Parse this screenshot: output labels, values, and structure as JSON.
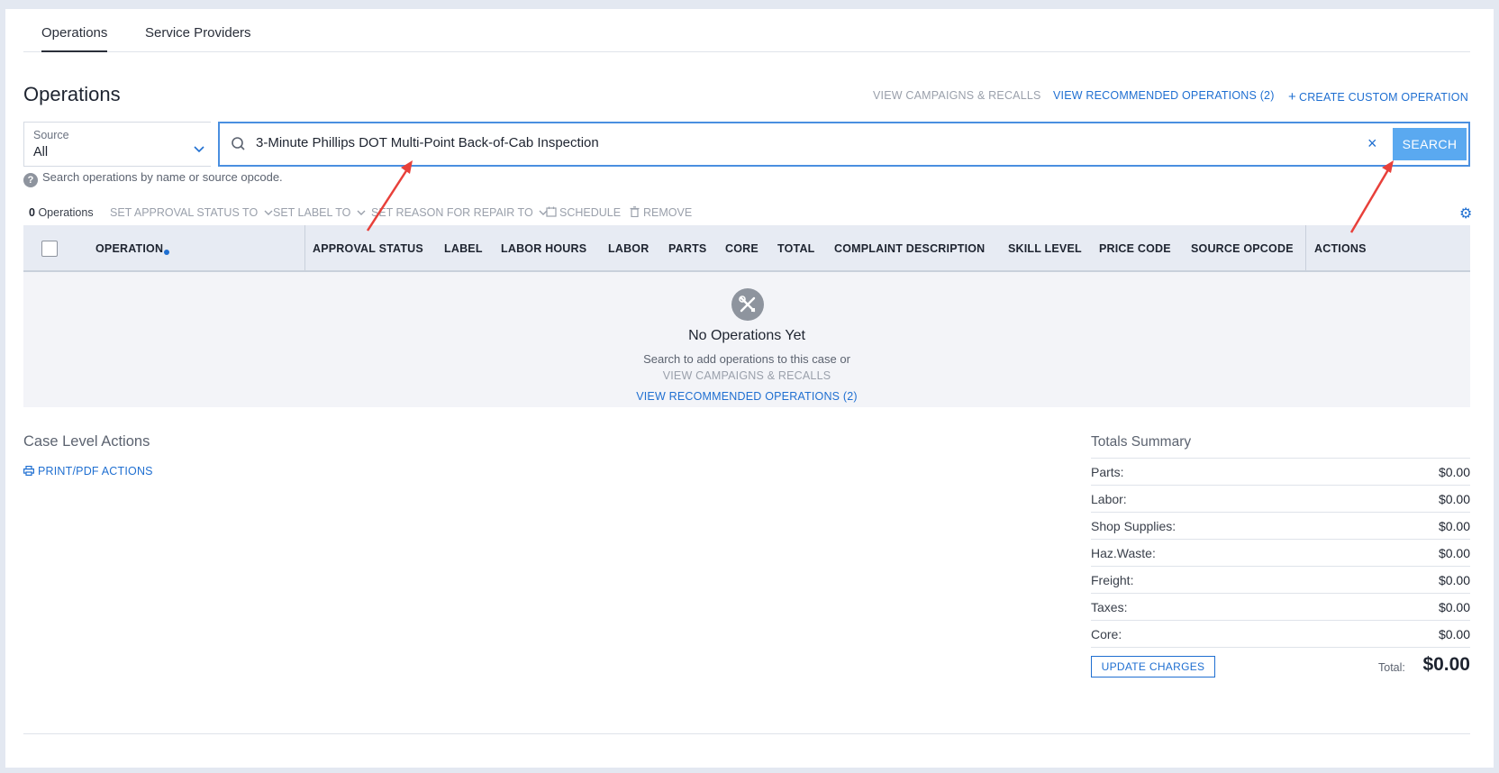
{
  "tabs": [
    {
      "label": "Operations",
      "active": true
    },
    {
      "label": "Service Providers",
      "active": false
    }
  ],
  "header": {
    "title": "Operations",
    "links": {
      "campaigns": "VIEW CAMPAIGNS & RECALLS",
      "recommended": "VIEW RECOMMENDED OPERATIONS (2)",
      "create": "CREATE CUSTOM OPERATION"
    }
  },
  "source": {
    "label": "Source",
    "value": "All"
  },
  "search": {
    "value": "3-Minute Phillips DOT Multi-Point Back-of-Cab Inspection",
    "clear": "×",
    "button": "SEARCH",
    "hint": "Search operations by name or source opcode."
  },
  "toolbar": {
    "count": "0",
    "count_label": "Operations",
    "approval": "SET APPROVAL STATUS TO",
    "label": "SET LABEL TO",
    "reason": "SET REASON FOR REPAIR TO",
    "schedule": "SCHEDULE",
    "remove": "REMOVE"
  },
  "table": {
    "columns": {
      "operation": "OPERATION",
      "approval_status": "APPROVAL STATUS",
      "label": "LABEL",
      "labor_hours": "LABOR HOURS",
      "labor": "LABOR",
      "parts": "PARTS",
      "core": "CORE",
      "total": "TOTAL",
      "complaint": "COMPLAINT DESCRIPTION",
      "skill": "SKILL LEVEL",
      "price_code": "PRICE CODE",
      "source_opcode": "SOURCE OPCODE",
      "actions": "ACTIONS"
    }
  },
  "empty_state": {
    "title": "No Operations Yet",
    "text": "Search to add operations to this case or",
    "campaigns_link": "VIEW CAMPAIGNS & RECALLS",
    "recommended_link": "VIEW RECOMMENDED OPERATIONS (2)"
  },
  "case_actions": {
    "title": "Case Level Actions",
    "print": "PRINT/PDF ACTIONS"
  },
  "totals": {
    "title": "Totals Summary",
    "rows": [
      {
        "label": "Parts:",
        "value": "$0.00"
      },
      {
        "label": "Labor:",
        "value": "$0.00"
      },
      {
        "label": "Shop Supplies:",
        "value": "$0.00"
      },
      {
        "label": "Haz.Waste:",
        "value": "$0.00"
      },
      {
        "label": "Freight:",
        "value": "$0.00"
      },
      {
        "label": "Taxes:",
        "value": "$0.00"
      },
      {
        "label": "Core:",
        "value": "$0.00"
      }
    ],
    "update_button": "UPDATE CHARGES",
    "total_label": "Total:",
    "total_value": "$0.00"
  },
  "colors": {
    "accent": "#1f6fd1",
    "search_button": "#5aa9f0",
    "annotation_arrow": "#e8403a"
  },
  "icons": {
    "search": "search-icon",
    "clear": "close-icon",
    "help": "question-icon",
    "schedule": "calendar-icon",
    "remove": "trash-icon",
    "settings": "gear-icon",
    "empty": "tools-icon",
    "print": "printer-icon",
    "dropdown": "chevron-down-icon"
  }
}
